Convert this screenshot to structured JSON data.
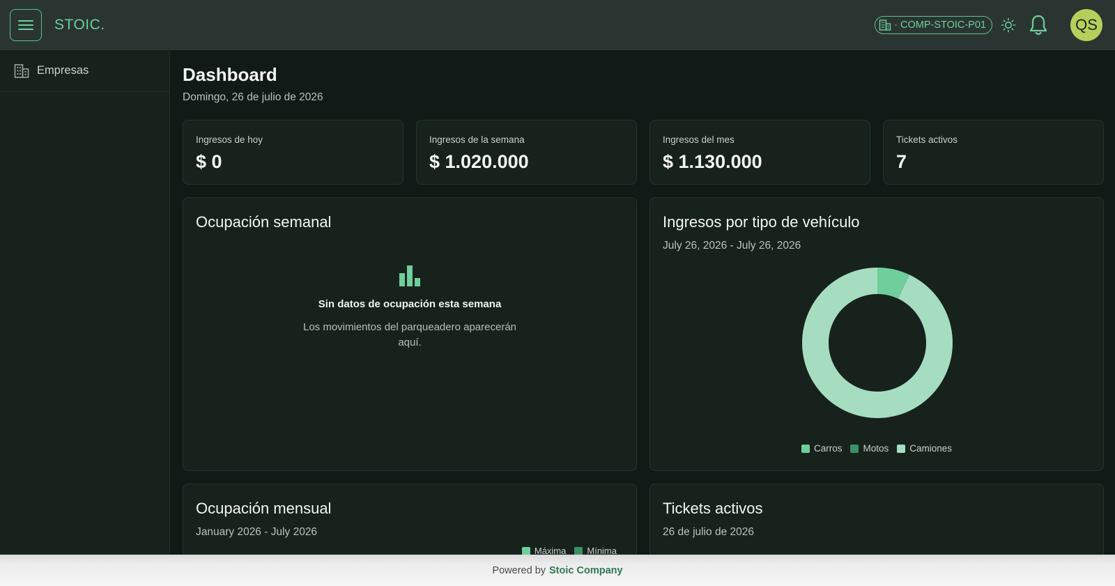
{
  "header": {
    "brand": "STOIC.",
    "company_prefix": "·",
    "company_code": "COMP-STOIC-P01",
    "avatar_initials": "QS"
  },
  "sidebar": {
    "items": [
      {
        "label": "Empresas",
        "icon": "building-icon"
      }
    ]
  },
  "page": {
    "title": "Dashboard",
    "date": "Domingo, 26 de julio de 2026"
  },
  "stats": [
    {
      "label": "Ingresos de hoy",
      "value": "$ 0"
    },
    {
      "label": "Ingresos de la semana",
      "value": "$ 1.020.000"
    },
    {
      "label": "Ingresos del mes",
      "value": "$ 1.130.000"
    },
    {
      "label": "Tickets activos",
      "value": "7"
    }
  ],
  "weekly": {
    "title": "Ocupación semanal",
    "empty_title": "Sin datos de ocupación esta semana",
    "empty_text": "Los movimientos del parqueadero aparecerán aquí."
  },
  "vehicle_income": {
    "title": "Ingresos por tipo de vehículo",
    "range": "July 26, 2026 - July 26, 2026"
  },
  "monthly": {
    "title": "Ocupación mensual",
    "range": "January 2026 - July 2026",
    "legend": [
      "Máxima",
      "Mínima"
    ]
  },
  "active_tickets": {
    "title": "Tickets activos",
    "date": "26 de julio de 2026"
  },
  "footer": {
    "prefix": "Powered by",
    "link": "Stoic Company"
  },
  "colors": {
    "accent": "#6fce9c",
    "carros": "#6fce9c",
    "motos": "#3e8f65",
    "camiones": "#a6dcbf",
    "avatar": "#b5cf5a"
  },
  "chart_data": {
    "type": "pie",
    "categories": [
      "Carros",
      "Motos",
      "Camiones"
    ],
    "values": [
      7,
      0,
      93
    ],
    "legend": "bottom"
  }
}
